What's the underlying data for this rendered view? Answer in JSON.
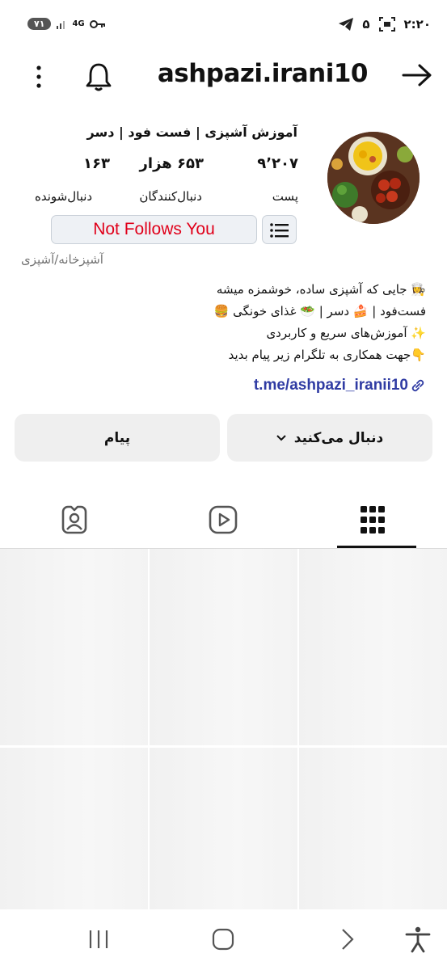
{
  "status_bar": {
    "time": "۲:۲۰",
    "notification_count": "۵",
    "network": "4G",
    "battery": "۷۱",
    "icons": [
      "telegram-icon",
      "screenshot-icon",
      "key-icon",
      "signal-icon"
    ]
  },
  "header": {
    "username": "ashpazi.irani10",
    "icons": [
      "back-arrow-icon",
      "bell-icon",
      "more-icon"
    ]
  },
  "profile": {
    "display_name": "آموزش آشپزی | فست فود | دسر",
    "stats": {
      "posts": {
        "value": "۹٬۲۰۷",
        "label": "پست"
      },
      "followers": {
        "value": "۶۵۳ هزار",
        "label": "دنبال‌کنندگان"
      },
      "following": {
        "value": "۱۶۳",
        "label": "دنبال‌شونده"
      }
    },
    "not_follows_label": "Not Follows You",
    "category": "آشپزخانه/آشپزی",
    "bio": [
      "👩‍🍳 جایی که آشپزی ساده، خوشمزه میشه",
      "فست‌فود | 🍰 دسر | 🥗 غذای خونگی 🍔",
      "✨ آموزش‌های سریع و کاربردی",
      "👇جهت همکاری به تلگرام زیر پیام بدید"
    ],
    "link": "t.me/ashpazi_iranii10"
  },
  "actions": {
    "following_label": "دنبال می‌کنید",
    "message_label": "پیام"
  },
  "tabs": [
    "grid-icon",
    "reels-icon",
    "tagged-icon"
  ],
  "theme": {
    "accent_red": "#e0001a",
    "link_blue": "#2f3ba3",
    "button_bg": "#efefef"
  }
}
